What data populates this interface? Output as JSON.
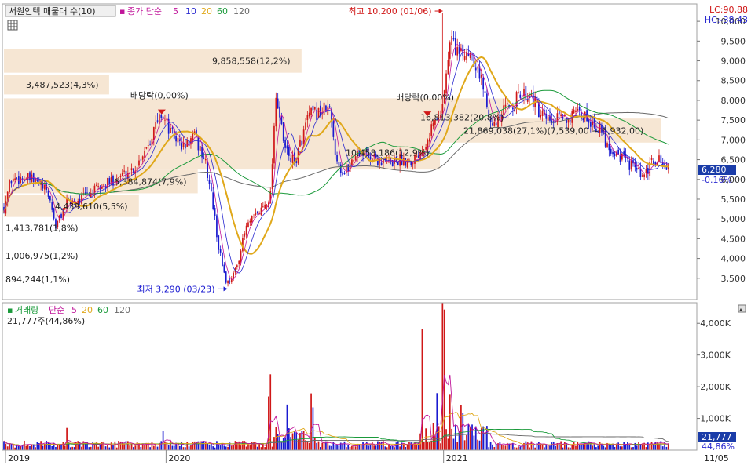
{
  "header": {
    "symbol_label": "서원인텍 매물대 수(10)",
    "indicator_label": "종가 단순",
    "ma_periods": [
      "5",
      "10",
      "20",
      "60",
      "120"
    ],
    "lc_value": "LC:90,88",
    "hc_value": "HC:-38,43"
  },
  "volume_header": {
    "label": "거래량",
    "ma_label": "단순",
    "ma_periods": [
      "5",
      "20",
      "60",
      "120"
    ],
    "volume_value": "21,777주(44,86%)"
  },
  "price_badge": {
    "price": "6,280",
    "change": "-0.16%"
  },
  "volume_badge": {
    "volume": "21,777",
    "pct": "44,86%"
  },
  "date_corner": "11/05",
  "colors": {
    "ma5": "#c0169a",
    "ma10": "#2a2ad0",
    "ma20": "#e0a81a",
    "ma60": "#1a9a3a",
    "ma120": "#6a6a6a",
    "candle_up": "#d01818",
    "candle_down": "#1a1ad0",
    "volume_profile": "#f6e6d3",
    "badge": "#1a3ca8"
  },
  "chart_data": {
    "type": "candlestick",
    "x_axis": {
      "year_labels": [
        {
          "label": "2019",
          "t": 0.0
        },
        {
          "label": "2020",
          "t": 0.232
        },
        {
          "label": "2021",
          "t": 0.633
        }
      ]
    },
    "price_axis": {
      "range": [
        3000,
        10300
      ],
      "ticks": [
        "3,500",
        "4,000",
        "4,500",
        "5,000",
        "5,500",
        "6,000",
        "6,500",
        "7,000",
        "7,500",
        "8,000",
        "8,500",
        "9,000",
        "9,500",
        "10,000"
      ],
      "tick_values": [
        3500,
        4000,
        4500,
        5000,
        5500,
        6000,
        6500,
        7000,
        7500,
        8000,
        8500,
        9000,
        9500,
        10000
      ]
    },
    "volume_axis": {
      "range": [
        0,
        4500
      ],
      "unit": "K",
      "ticks": [
        "1,000K",
        "2,000K",
        "3,000K",
        "4,000K"
      ],
      "tick_values": [
        1000,
        2000,
        3000,
        4000
      ]
    },
    "price_keypoints": [
      [
        0.0,
        5300
      ],
      [
        0.01,
        6000
      ],
      [
        0.03,
        6050
      ],
      [
        0.05,
        5900
      ],
      [
        0.065,
        5600
      ],
      [
        0.075,
        4800
      ],
      [
        0.09,
        5400
      ],
      [
        0.11,
        5500
      ],
      [
        0.13,
        5700
      ],
      [
        0.16,
        6000
      ],
      [
        0.19,
        6300
      ],
      [
        0.21,
        7000
      ],
      [
        0.228,
        7700
      ],
      [
        0.24,
        7200
      ],
      [
        0.26,
        6800
      ],
      [
        0.275,
        7100
      ],
      [
        0.29,
        6500
      ],
      [
        0.3,
        5600
      ],
      [
        0.31,
        4300
      ],
      [
        0.322,
        3350
      ],
      [
        0.335,
        3700
      ],
      [
        0.35,
        4800
      ],
      [
        0.37,
        5200
      ],
      [
        0.385,
        5600
      ],
      [
        0.393,
        8200
      ],
      [
        0.405,
        6800
      ],
      [
        0.42,
        6400
      ],
      [
        0.44,
        7600
      ],
      [
        0.47,
        7800
      ],
      [
        0.48,
        6600
      ],
      [
        0.49,
        6100
      ],
      [
        0.51,
        6700
      ],
      [
        0.53,
        6600
      ],
      [
        0.55,
        6400
      ],
      [
        0.57,
        6500
      ],
      [
        0.59,
        6500
      ],
      [
        0.605,
        6800
      ],
      [
        0.62,
        7400
      ],
      [
        0.63,
        7600
      ],
      [
        0.64,
        8700
      ],
      [
        0.645,
        9600
      ],
      [
        0.66,
        9100
      ],
      [
        0.675,
        9300
      ],
      [
        0.69,
        8500
      ],
      [
        0.7,
        7800
      ],
      [
        0.71,
        7300
      ],
      [
        0.725,
        7800
      ],
      [
        0.745,
        8100
      ],
      [
        0.76,
        8200
      ],
      [
        0.775,
        7600
      ],
      [
        0.79,
        7400
      ],
      [
        0.81,
        7600
      ],
      [
        0.84,
        7600
      ],
      [
        0.86,
        7300
      ],
      [
        0.875,
        6800
      ],
      [
        0.89,
        6600
      ],
      [
        0.91,
        6300
      ],
      [
        0.925,
        6000
      ],
      [
        0.935,
        6400
      ],
      [
        0.945,
        6500
      ],
      [
        0.96,
        6300
      ]
    ],
    "events": [
      {
        "type": "high",
        "label": "최고 10,200 (01/06)",
        "value": 10200,
        "t": 0.634
      },
      {
        "type": "low",
        "label": "최저 3,290 (03/23)",
        "value": 3290,
        "t": 0.323
      },
      {
        "type": "dividend",
        "label": "배당락(0,00%)",
        "t": 0.228,
        "value": 7650
      },
      {
        "type": "dividend",
        "label": "배당락(0,00%)",
        "t": 0.612,
        "value": 7600
      }
    ],
    "volume_profile": [
      {
        "label": "894,244(1,1%)",
        "low": 3300,
        "high": 3650,
        "width": 0.0
      },
      {
        "label": "1,006,975(1,2%)",
        "low": 3900,
        "high": 4250,
        "width": 0.0
      },
      {
        "label": "1,413,781(1,8%)",
        "low": 4600,
        "high": 4950,
        "width": 0.0
      },
      {
        "label": "4,439,610(5,5%)",
        "low": 5050,
        "high": 5600,
        "width": 0.195
      },
      {
        "label": "6,384,874(7,9%)",
        "low": 5650,
        "high": 6250,
        "width": 0.28
      },
      {
        "label": "10,458,186(12,9%)",
        "low": 6250,
        "high": 7100,
        "width": 0.63
      },
      {
        "label": "16,813,382(20,8%)",
        "low": 7100,
        "high": 8050,
        "width": 0.73
      },
      {
        "label": "3,487,523(4,3%)",
        "low": 8150,
        "high": 8650,
        "width": 0.152
      },
      {
        "label": "9,858,558(12,2%)",
        "low": 8700,
        "high": 9300,
        "width": 0.43
      },
      {
        "label": "21,869,038(27,1%)(7,539,00 ~ 6,932,00)",
        "low": 6932,
        "high": 7539,
        "width": 0.95
      }
    ]
  }
}
